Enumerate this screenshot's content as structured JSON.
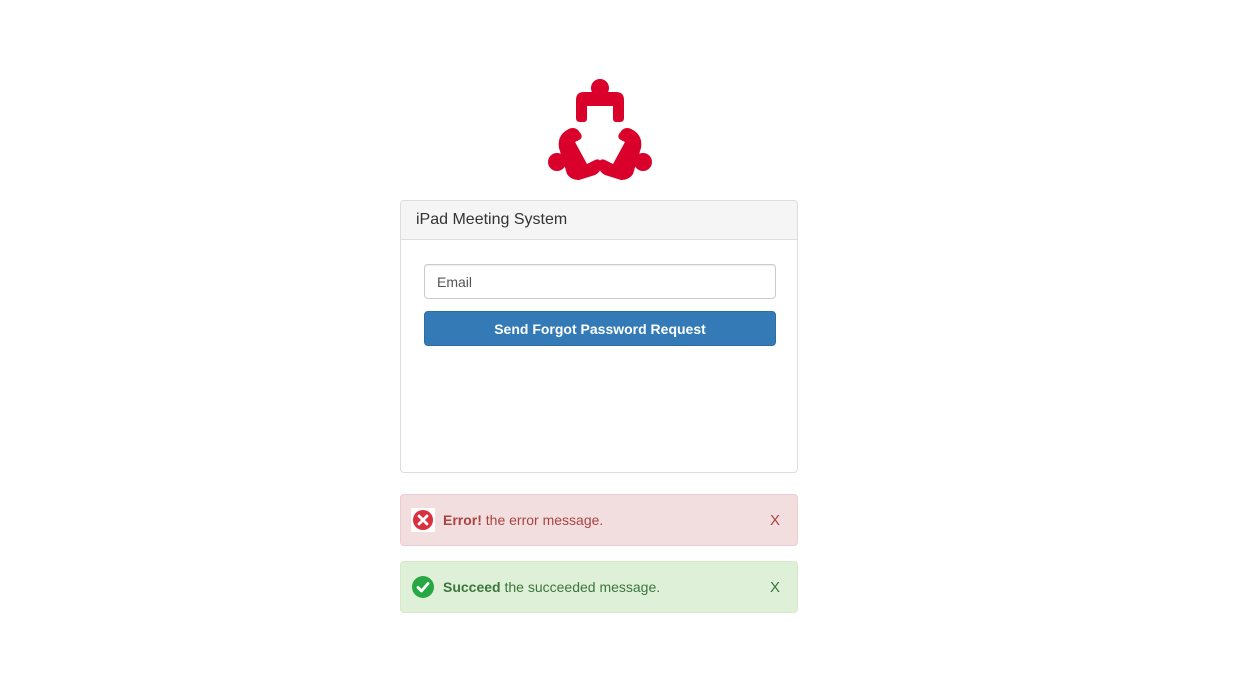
{
  "logo": {
    "icon": "meeting-people-icon",
    "color": "#d9002b"
  },
  "panel": {
    "title": "iPad Meeting System",
    "email_placeholder": "Email",
    "submit_label": "Send Forgot Password Request"
  },
  "alerts": {
    "error": {
      "icon": "error-x-icon",
      "label": "Error!",
      "message": "the error message.",
      "close": "X",
      "color": "#a94442"
    },
    "success": {
      "icon": "check-circle-icon",
      "label": "Succeed",
      "message": "the succeeded message.",
      "close": "X",
      "color": "#3c763d"
    }
  },
  "colors": {
    "primary": "#337ab7",
    "brand": "#d9002b"
  }
}
